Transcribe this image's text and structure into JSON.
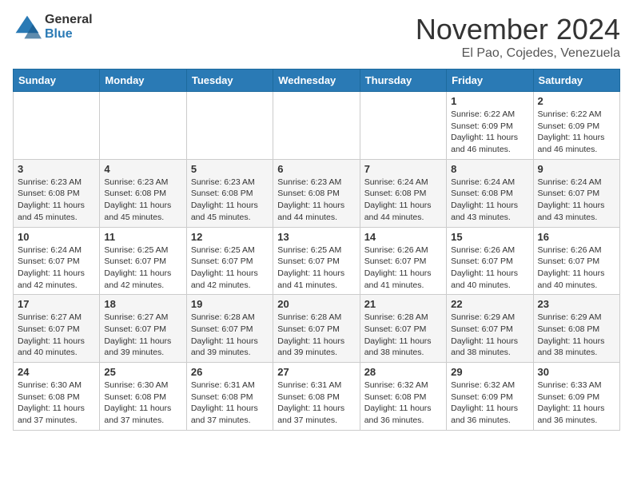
{
  "logo": {
    "general": "General",
    "blue": "Blue"
  },
  "title": "November 2024",
  "location": "El Pao, Cojedes, Venezuela",
  "weekdays": [
    "Sunday",
    "Monday",
    "Tuesday",
    "Wednesday",
    "Thursday",
    "Friday",
    "Saturday"
  ],
  "weeks": [
    [
      {
        "day": "",
        "info": ""
      },
      {
        "day": "",
        "info": ""
      },
      {
        "day": "",
        "info": ""
      },
      {
        "day": "",
        "info": ""
      },
      {
        "day": "",
        "info": ""
      },
      {
        "day": "1",
        "info": "Sunrise: 6:22 AM\nSunset: 6:09 PM\nDaylight: 11 hours and 46 minutes."
      },
      {
        "day": "2",
        "info": "Sunrise: 6:22 AM\nSunset: 6:09 PM\nDaylight: 11 hours and 46 minutes."
      }
    ],
    [
      {
        "day": "3",
        "info": "Sunrise: 6:23 AM\nSunset: 6:08 PM\nDaylight: 11 hours and 45 minutes."
      },
      {
        "day": "4",
        "info": "Sunrise: 6:23 AM\nSunset: 6:08 PM\nDaylight: 11 hours and 45 minutes."
      },
      {
        "day": "5",
        "info": "Sunrise: 6:23 AM\nSunset: 6:08 PM\nDaylight: 11 hours and 45 minutes."
      },
      {
        "day": "6",
        "info": "Sunrise: 6:23 AM\nSunset: 6:08 PM\nDaylight: 11 hours and 44 minutes."
      },
      {
        "day": "7",
        "info": "Sunrise: 6:24 AM\nSunset: 6:08 PM\nDaylight: 11 hours and 44 minutes."
      },
      {
        "day": "8",
        "info": "Sunrise: 6:24 AM\nSunset: 6:08 PM\nDaylight: 11 hours and 43 minutes."
      },
      {
        "day": "9",
        "info": "Sunrise: 6:24 AM\nSunset: 6:07 PM\nDaylight: 11 hours and 43 minutes."
      }
    ],
    [
      {
        "day": "10",
        "info": "Sunrise: 6:24 AM\nSunset: 6:07 PM\nDaylight: 11 hours and 42 minutes."
      },
      {
        "day": "11",
        "info": "Sunrise: 6:25 AM\nSunset: 6:07 PM\nDaylight: 11 hours and 42 minutes."
      },
      {
        "day": "12",
        "info": "Sunrise: 6:25 AM\nSunset: 6:07 PM\nDaylight: 11 hours and 42 minutes."
      },
      {
        "day": "13",
        "info": "Sunrise: 6:25 AM\nSunset: 6:07 PM\nDaylight: 11 hours and 41 minutes."
      },
      {
        "day": "14",
        "info": "Sunrise: 6:26 AM\nSunset: 6:07 PM\nDaylight: 11 hours and 41 minutes."
      },
      {
        "day": "15",
        "info": "Sunrise: 6:26 AM\nSunset: 6:07 PM\nDaylight: 11 hours and 40 minutes."
      },
      {
        "day": "16",
        "info": "Sunrise: 6:26 AM\nSunset: 6:07 PM\nDaylight: 11 hours and 40 minutes."
      }
    ],
    [
      {
        "day": "17",
        "info": "Sunrise: 6:27 AM\nSunset: 6:07 PM\nDaylight: 11 hours and 40 minutes."
      },
      {
        "day": "18",
        "info": "Sunrise: 6:27 AM\nSunset: 6:07 PM\nDaylight: 11 hours and 39 minutes."
      },
      {
        "day": "19",
        "info": "Sunrise: 6:28 AM\nSunset: 6:07 PM\nDaylight: 11 hours and 39 minutes."
      },
      {
        "day": "20",
        "info": "Sunrise: 6:28 AM\nSunset: 6:07 PM\nDaylight: 11 hours and 39 minutes."
      },
      {
        "day": "21",
        "info": "Sunrise: 6:28 AM\nSunset: 6:07 PM\nDaylight: 11 hours and 38 minutes."
      },
      {
        "day": "22",
        "info": "Sunrise: 6:29 AM\nSunset: 6:07 PM\nDaylight: 11 hours and 38 minutes."
      },
      {
        "day": "23",
        "info": "Sunrise: 6:29 AM\nSunset: 6:08 PM\nDaylight: 11 hours and 38 minutes."
      }
    ],
    [
      {
        "day": "24",
        "info": "Sunrise: 6:30 AM\nSunset: 6:08 PM\nDaylight: 11 hours and 37 minutes."
      },
      {
        "day": "25",
        "info": "Sunrise: 6:30 AM\nSunset: 6:08 PM\nDaylight: 11 hours and 37 minutes."
      },
      {
        "day": "26",
        "info": "Sunrise: 6:31 AM\nSunset: 6:08 PM\nDaylight: 11 hours and 37 minutes."
      },
      {
        "day": "27",
        "info": "Sunrise: 6:31 AM\nSunset: 6:08 PM\nDaylight: 11 hours and 37 minutes."
      },
      {
        "day": "28",
        "info": "Sunrise: 6:32 AM\nSunset: 6:08 PM\nDaylight: 11 hours and 36 minutes."
      },
      {
        "day": "29",
        "info": "Sunrise: 6:32 AM\nSunset: 6:09 PM\nDaylight: 11 hours and 36 minutes."
      },
      {
        "day": "30",
        "info": "Sunrise: 6:33 AM\nSunset: 6:09 PM\nDaylight: 11 hours and 36 minutes."
      }
    ]
  ]
}
